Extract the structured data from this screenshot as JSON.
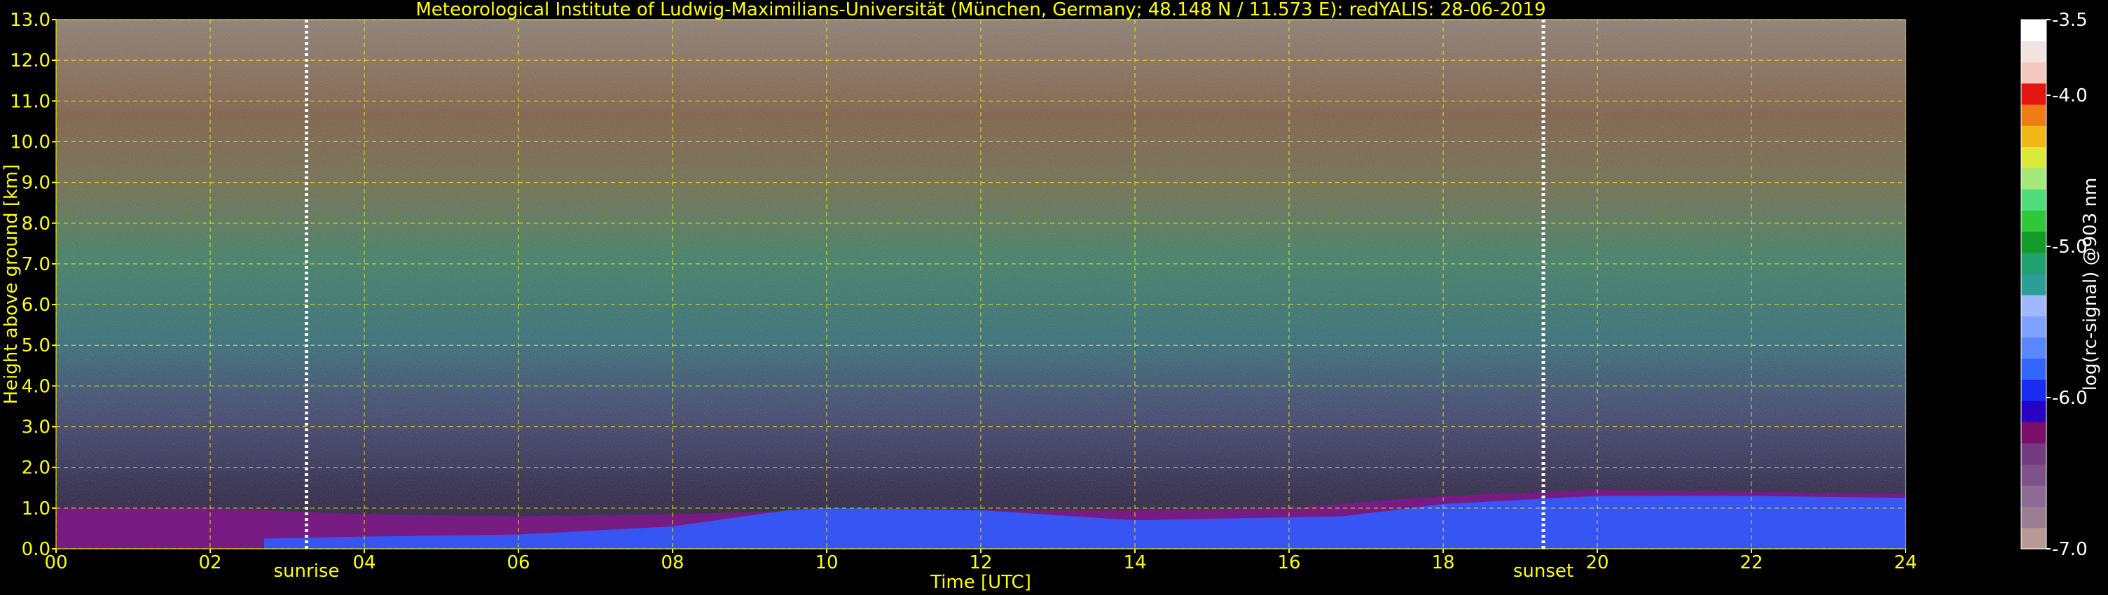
{
  "chart_data": {
    "type": "heatmap",
    "title": "Meteorological Institute of Ludwig-Maximilians-Universität (München, Germany; 48.148 N / 11.573 E):    redYALIS: 28-06-2019",
    "xlabel": "Time [UTC]",
    "ylabel": "Height above ground [km]",
    "xlim": [
      0,
      24
    ],
    "ylim": [
      0.0,
      13.0
    ],
    "x_ticks": [
      "00",
      "02",
      "04",
      "06",
      "08",
      "10",
      "12",
      "14",
      "16",
      "18",
      "20",
      "22",
      "24"
    ],
    "y_ticks": [
      "0.0",
      "1.0",
      "2.0",
      "3.0",
      "4.0",
      "5.0",
      "6.0",
      "7.0",
      "8.0",
      "9.0",
      "10.0",
      "11.0",
      "12.0",
      "13.0"
    ],
    "grid": true,
    "markers": [
      {
        "label": "sunrise",
        "time": 3.25
      },
      {
        "label": "sunset",
        "time": 19.3
      }
    ],
    "colorbar": {
      "label": "log(rc-signal) @903 nm",
      "range": [
        -7.0,
        -3.5
      ],
      "ticks": [
        "-7.0",
        "-6.0",
        "-5.0",
        "-4.0",
        "-3.5"
      ],
      "colors": [
        "#b89a94",
        "#9a7f93",
        "#8d6b93",
        "#7f5189",
        "#743a7f",
        "#7a0f6a",
        "#2b00c6",
        "#1a2cf1",
        "#3366ff",
        "#5a86ff",
        "#7fa2ff",
        "#9fb8ff",
        "#2b9e95",
        "#21a070",
        "#149a28",
        "#2ec83a",
        "#4fde7a",
        "#a4e77a",
        "#d9ea3a",
        "#f2b81a",
        "#f07a14",
        "#e41612",
        "#f5c9bf",
        "#f0e4e1",
        "#ffffff"
      ]
    },
    "aerosol_layer_top_km": [
      {
        "time": 0.0,
        "top": 1.0
      },
      {
        "time": 2.0,
        "top": 1.0
      },
      {
        "time": 4.0,
        "top": 0.85
      },
      {
        "time": 6.0,
        "top": 0.8
      },
      {
        "time": 8.0,
        "top": 0.85
      },
      {
        "time": 10.0,
        "top": 0.95
      },
      {
        "time": 12.0,
        "top": 0.95
      },
      {
        "time": 14.0,
        "top": 0.95
      },
      {
        "time": 16.0,
        "top": 1.0
      },
      {
        "time": 18.0,
        "top": 1.3
      },
      {
        "time": 20.0,
        "top": 1.45
      },
      {
        "time": 22.0,
        "top": 1.4
      },
      {
        "time": 24.0,
        "top": 1.35
      }
    ],
    "blue_boundary_layer_top_km": [
      {
        "time": 2.7,
        "top": 0.25
      },
      {
        "time": 4.0,
        "top": 0.3
      },
      {
        "time": 6.0,
        "top": 0.35
      },
      {
        "time": 8.0,
        "top": 0.55
      },
      {
        "time": 9.5,
        "top": 0.95
      },
      {
        "time": 10.0,
        "top": 1.0
      },
      {
        "time": 12.0,
        "top": 0.95
      },
      {
        "time": 14.0,
        "top": 0.7
      },
      {
        "time": 16.7,
        "top": 0.8
      },
      {
        "time": 18.0,
        "top": 1.1
      },
      {
        "time": 20.0,
        "top": 1.3
      },
      {
        "time": 22.0,
        "top": 1.3
      },
      {
        "time": 24.0,
        "top": 1.25
      }
    ]
  }
}
